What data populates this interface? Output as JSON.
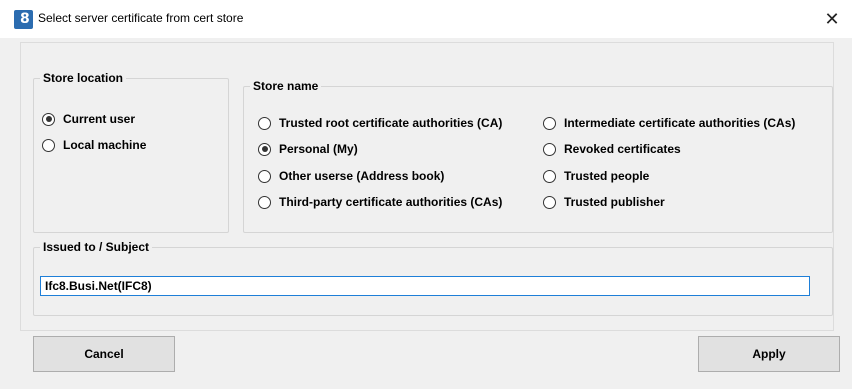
{
  "window": {
    "title": "Select server certificate from cert store",
    "icon": "ifc8-app-icon",
    "icon_glyph": "8"
  },
  "store_location": {
    "title": "Store location",
    "options": [
      {
        "label": "Current user",
        "checked": true
      },
      {
        "label": "Local machine",
        "checked": false
      }
    ]
  },
  "store_name": {
    "title": "Store name",
    "options": [
      {
        "label": "Trusted root certificate authorities (CA)",
        "checked": false
      },
      {
        "label": "Personal (My)",
        "checked": true
      },
      {
        "label": "Other userse (Address book)",
        "checked": false
      },
      {
        "label": "Third-party certificate authorities (CAs)",
        "checked": false
      },
      {
        "label": "Intermediate certificate authorities (CAs)",
        "checked": false
      },
      {
        "label": "Revoked certificates",
        "checked": false
      },
      {
        "label": "Trusted people",
        "checked": false
      },
      {
        "label": "Trusted publisher",
        "checked": false
      }
    ]
  },
  "issued_to": {
    "title": "Issued to / Subject",
    "value": "Ifc8.Busi.Net(IFC8)"
  },
  "buttons": {
    "cancel": "Cancel",
    "apply": "Apply"
  },
  "colors": {
    "dialog_bg": "#f0f0f0",
    "input_border": "#1e7fd8",
    "button_bg": "#e1e1e1"
  }
}
